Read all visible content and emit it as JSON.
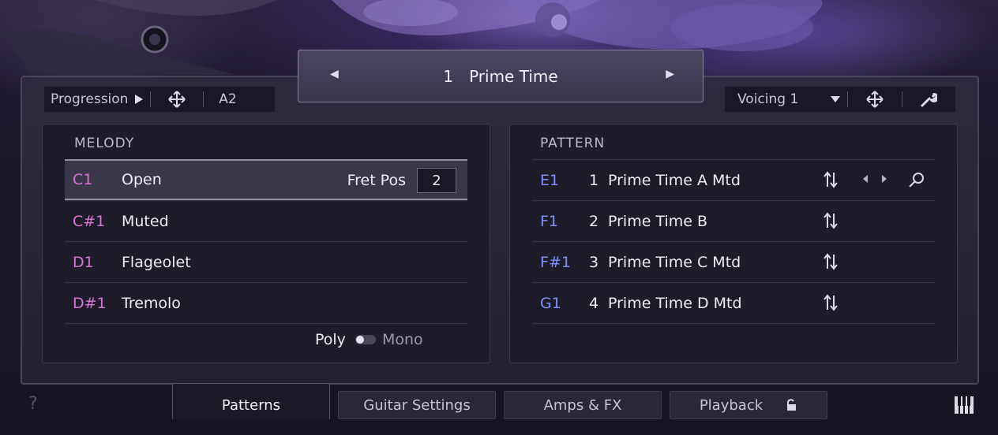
{
  "preset": {
    "number": "1",
    "name": "Prime Time"
  },
  "toolbar_left": {
    "progression_label": "Progression",
    "key": "A2"
  },
  "toolbar_right": {
    "voicing_label": "Voicing 1"
  },
  "melody": {
    "title": "MELODY",
    "rows": [
      {
        "note": "C1",
        "label": "Open"
      },
      {
        "note": "C#1",
        "label": "Muted"
      },
      {
        "note": "D1",
        "label": "Flageolet"
      },
      {
        "note": "D#1",
        "label": "Tremolo"
      }
    ],
    "fret_pos_label": "Fret Pos",
    "fret_pos_value": "2",
    "poly_label": "Poly",
    "mono_label": "Mono"
  },
  "pattern": {
    "title": "PATTERN",
    "rows": [
      {
        "note": "E1",
        "index": "1",
        "label": "Prime Time A Mtd"
      },
      {
        "note": "F1",
        "index": "2",
        "label": "Prime Time B"
      },
      {
        "note": "F#1",
        "index": "3",
        "label": "Prime Time C Mtd"
      },
      {
        "note": "G1",
        "index": "4",
        "label": "Prime Time D Mtd"
      }
    ]
  },
  "tabs": [
    {
      "label": "Patterns"
    },
    {
      "label": "Guitar Settings"
    },
    {
      "label": "Amps & FX"
    },
    {
      "label": "Playback"
    }
  ],
  "help": "?",
  "colors": {
    "melody_note": "#d873d8",
    "pattern_note": "#7f8fff",
    "panel_bg": "#1e1c28"
  }
}
